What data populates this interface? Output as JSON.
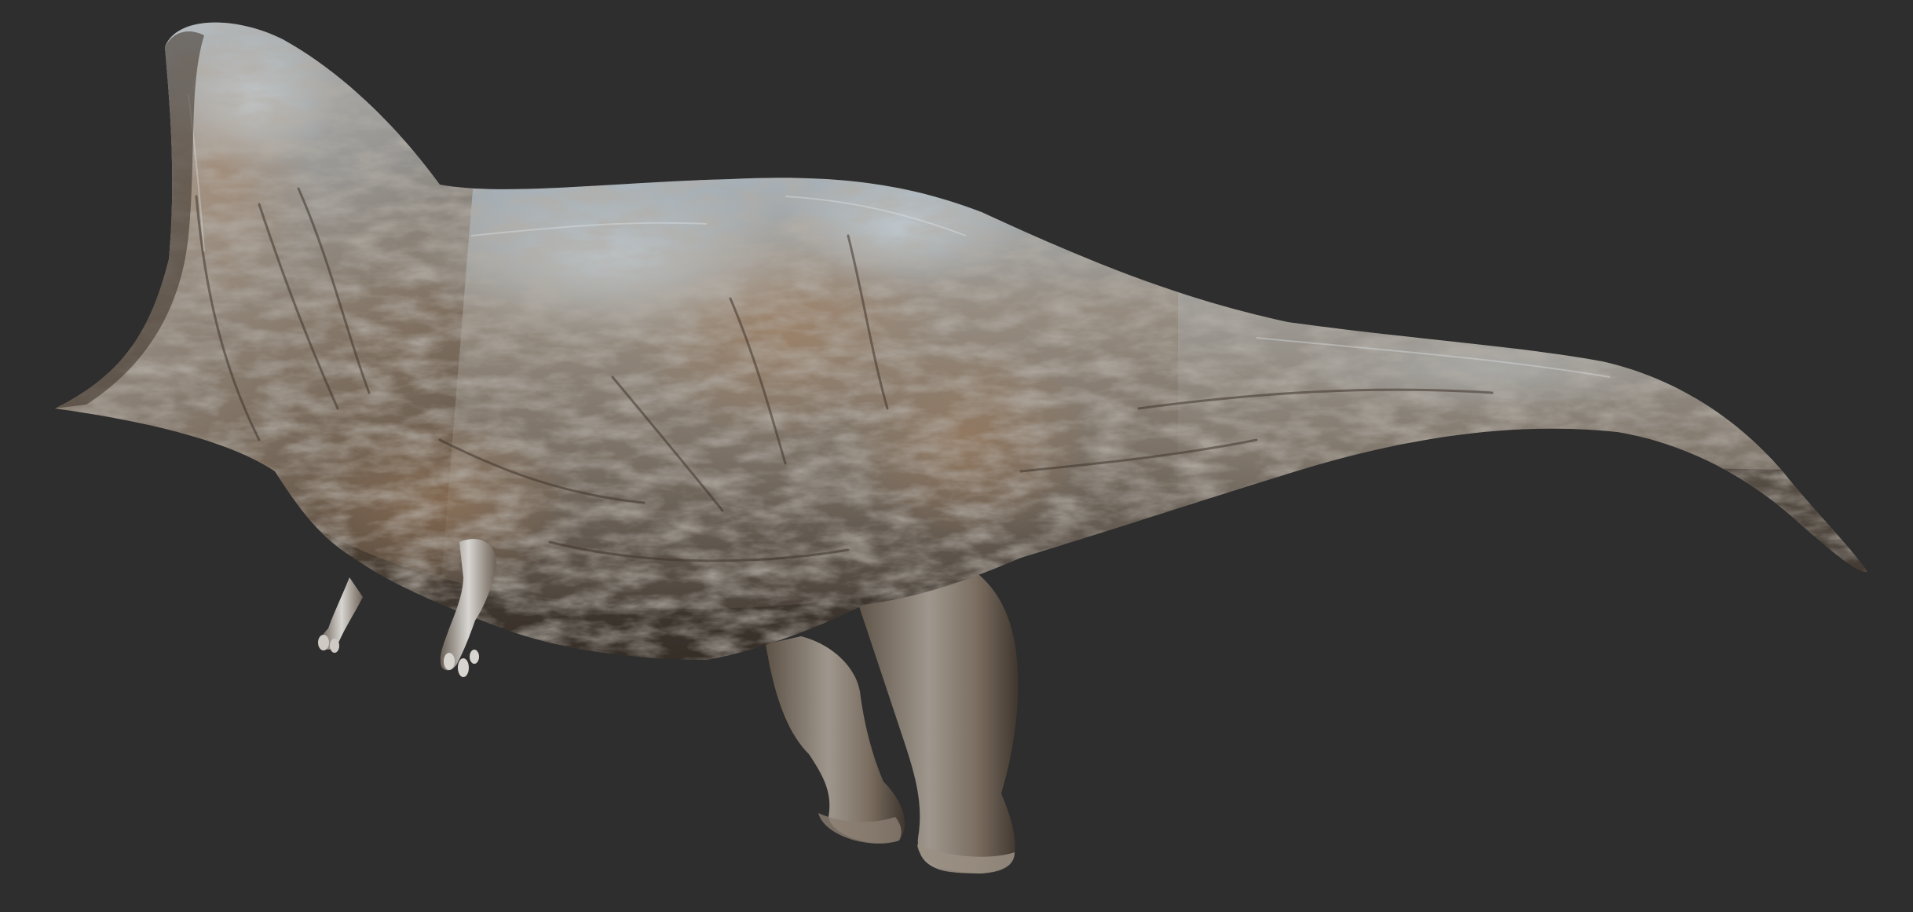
{
  "scene": {
    "subject": "dinosaur-sculpt",
    "background_color": "#2e2e2e",
    "skin_highlight_color": "#b9c8d4",
    "skin_midtone_color": "#8f8478",
    "skin_shadow_color": "#4a4138",
    "warm_tone_color": "#9c7a5a"
  }
}
